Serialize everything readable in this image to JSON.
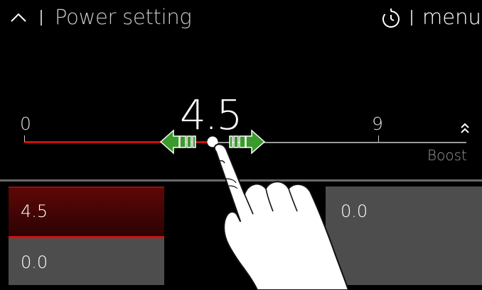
{
  "header": {
    "title": "Power setting",
    "menu_label": "menu"
  },
  "slider": {
    "min_label": "0",
    "max_label": "9",
    "current_value": "4.5",
    "boost_label": "Boost",
    "value": 4.5,
    "min": 0,
    "max": 9,
    "fill_color": "#c80f0f",
    "handle_color": "#3a9a2c"
  },
  "zones": {
    "left_top_value": "4.5",
    "left_bottom_value": "0.0",
    "right_value": "0.0"
  },
  "icons": {
    "back": "chevron-up-icon",
    "timer": "timer-icon",
    "boost": "double-chevron-up-icon",
    "handle": "slider-handle-arrows",
    "hand": "touch-hand-icon"
  },
  "colors": {
    "background": "#000000",
    "active_zone": "#5e0707",
    "inactive_zone": "#4d4d4d"
  }
}
